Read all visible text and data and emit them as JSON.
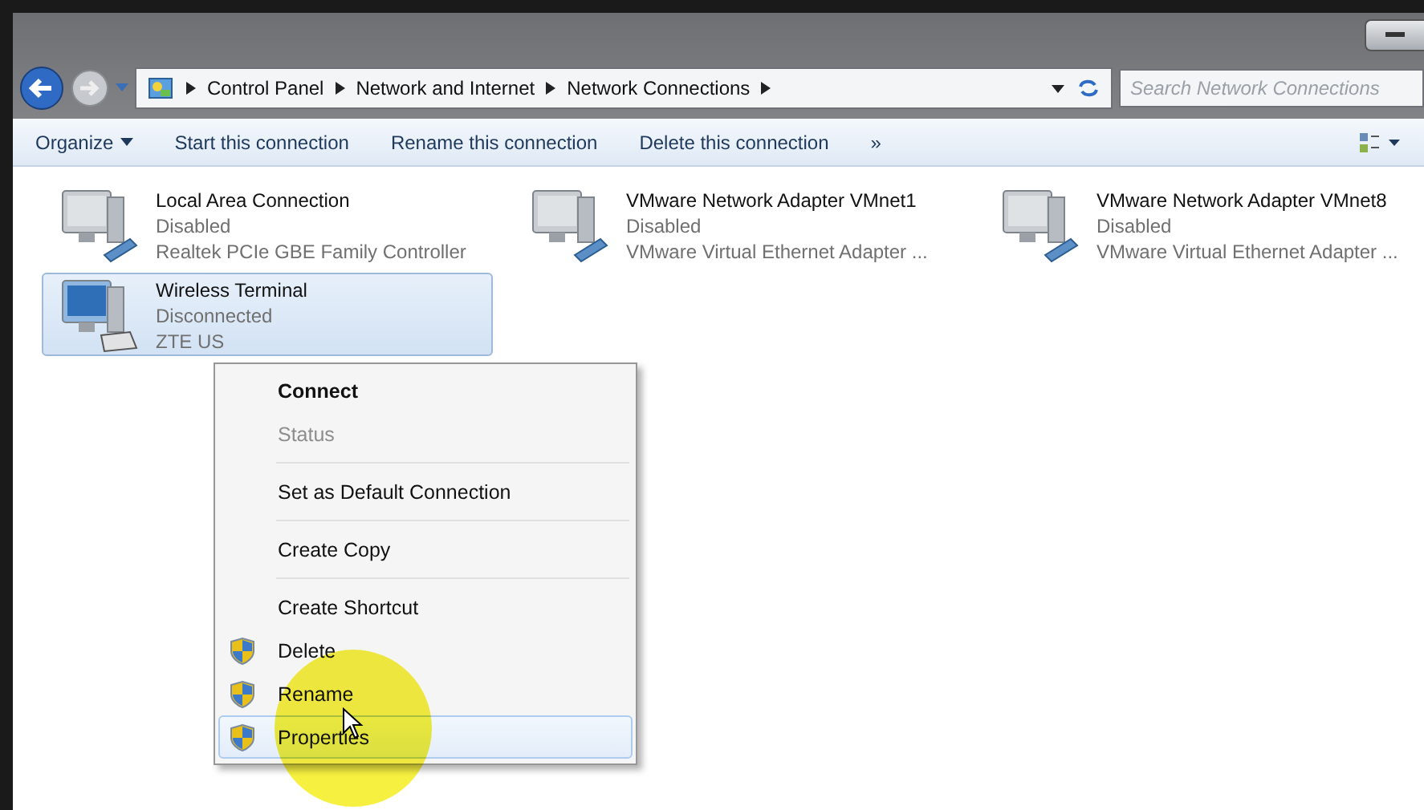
{
  "address_bar": {
    "crumbs": [
      "Control Panel",
      "Network and Internet",
      "Network Connections"
    ]
  },
  "search": {
    "placeholder": "Search Network Connections"
  },
  "toolbar": {
    "items": [
      {
        "label": "Organize",
        "dropdown": true
      },
      {
        "label": "Start this connection",
        "dropdown": false
      },
      {
        "label": "Rename this connection",
        "dropdown": false
      },
      {
        "label": "Delete this connection",
        "dropdown": false
      },
      {
        "label": "»",
        "dropdown": false
      }
    ]
  },
  "connections": [
    {
      "name": "Local Area Connection",
      "status": "Disabled",
      "adapter": "Realtek PCIe GBE Family Controller",
      "kind": "wired",
      "selected": false
    },
    {
      "name": "VMware Network Adapter VMnet1",
      "status": "Disabled",
      "adapter": "VMware Virtual Ethernet Adapter ...",
      "kind": "wired",
      "selected": false
    },
    {
      "name": "VMware Network Adapter VMnet8",
      "status": "Disabled",
      "adapter": "VMware Virtual Ethernet Adapter ...",
      "kind": "wired",
      "selected": false
    },
    {
      "name": "Wireless Terminal",
      "status": "Disconnected",
      "adapter": "ZTE US",
      "kind": "modem",
      "selected": true
    }
  ],
  "context_menu": {
    "items": [
      {
        "kind": "item",
        "label": "Connect",
        "default": true,
        "disabled": false,
        "shield": false,
        "selected": false
      },
      {
        "kind": "item",
        "label": "Status",
        "default": false,
        "disabled": true,
        "shield": false,
        "selected": false
      },
      {
        "kind": "separator"
      },
      {
        "kind": "item",
        "label": "Set as Default Connection",
        "default": false,
        "disabled": false,
        "shield": false,
        "selected": false
      },
      {
        "kind": "separator"
      },
      {
        "kind": "item",
        "label": "Create Copy",
        "default": false,
        "disabled": false,
        "shield": false,
        "selected": false
      },
      {
        "kind": "separator"
      },
      {
        "kind": "item",
        "label": "Create Shortcut",
        "default": false,
        "disabled": false,
        "shield": false,
        "selected": false
      },
      {
        "kind": "item",
        "label": "Delete",
        "default": false,
        "disabled": false,
        "shield": true,
        "selected": false
      },
      {
        "kind": "item",
        "label": "Rename",
        "default": false,
        "disabled": false,
        "shield": true,
        "selected": false
      },
      {
        "kind": "item",
        "label": "Properties",
        "default": false,
        "disabled": false,
        "shield": true,
        "selected": true
      }
    ]
  }
}
